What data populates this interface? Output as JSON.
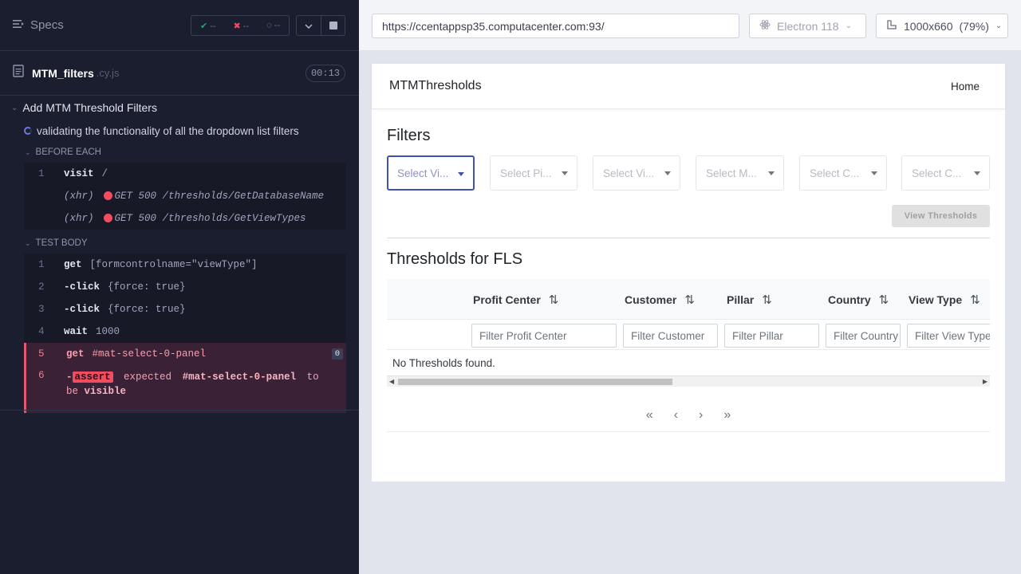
{
  "runner": {
    "specs_label": "Specs",
    "stats": {
      "passed": "--",
      "failed": "--",
      "pending": "--"
    },
    "spec_file": {
      "name": "MTM_filters",
      "ext": ".cy.js",
      "duration": "00:13"
    },
    "suite_title": "Add MTM Threshold Filters",
    "test_title": "validating the functionality of all the dropdown list filters",
    "before_each_label": "BEFORE EACH",
    "test_body_label": "TEST BODY",
    "before_each": [
      {
        "num": "1",
        "name": "visit",
        "msg": "/"
      },
      {
        "num": "",
        "xhr": "(xhr)",
        "msg": "GET 500 /thresholds/GetDatabaseName"
      },
      {
        "num": "",
        "xhr": "(xhr)",
        "msg": "GET 500 /thresholds/GetViewTypes"
      }
    ],
    "body": [
      {
        "num": "1",
        "name": "get",
        "msg": "[formcontrolname=\"viewType\"]"
      },
      {
        "num": "2",
        "name": "-click",
        "msg": "{force: true}"
      },
      {
        "num": "3",
        "name": "-click",
        "msg": "{force: true}"
      },
      {
        "num": "4",
        "name": "wait",
        "msg": "1000"
      },
      {
        "num": "5",
        "name": "get",
        "msg": "#mat-select-0-panel",
        "badge": "0"
      },
      {
        "num": "6",
        "prefix": "-",
        "name": "assert",
        "msg_a": "expected",
        "msg_b": "#mat-select-0-panel",
        "msg_c": "to be",
        "msg_d": "visible"
      }
    ]
  },
  "browser_bar": {
    "url": "https://ccentappsp35.computacenter.com:93/",
    "browser": "Electron 118",
    "viewport": "1000x660",
    "zoom": "(79%)"
  },
  "app": {
    "brand": "MTMThresholds",
    "home": "Home",
    "filters_title": "Filters",
    "selects": [
      "Select Vi...",
      "Select Pi...",
      "Select Vi...",
      "Select M...",
      "Select C...",
      "Select C..."
    ],
    "view_button": "View Thresholds",
    "thresholds_title": "Thresholds for FLS",
    "columns": [
      "Profit Center",
      "Customer",
      "Pillar",
      "Country",
      "View Type"
    ],
    "filter_placeholders": [
      "Filter Profit Center",
      "Filter Customer",
      "Filter Pillar",
      "Filter Country",
      "Filter View Type"
    ],
    "empty_message": "No Thresholds found.",
    "pager": {
      "first": "«",
      "prev": "‹",
      "next": "›",
      "last": "»"
    }
  }
}
